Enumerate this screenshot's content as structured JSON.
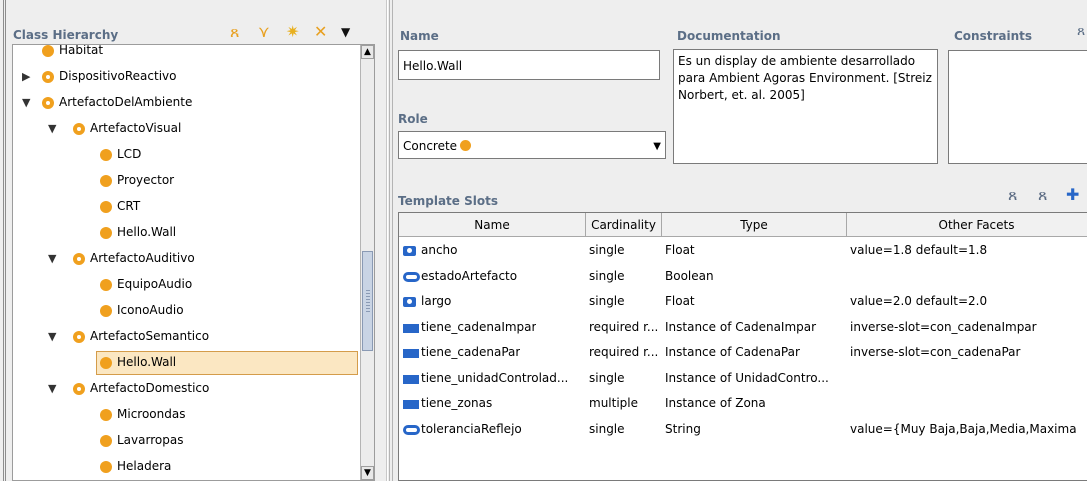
{
  "left": {
    "title": "Class Hierarchy",
    "header_icons": [
      "add-subclass-icon",
      "create-class-icon",
      "properties-icon",
      "delete-icon",
      "menu-chevron-icon"
    ],
    "tree": [
      {
        "label": "Habitat",
        "depth": 1,
        "toggle": "",
        "open": false,
        "selected": false
      },
      {
        "label": "DispositivoReactivo",
        "depth": 1,
        "toggle": "▶",
        "open": true,
        "selected": false
      },
      {
        "label": "ArtefactoDelAmbiente",
        "depth": 1,
        "toggle": "▼",
        "open": true,
        "selected": false
      },
      {
        "label": "ArtefactoVisual",
        "depth": 2,
        "toggle": "▼",
        "open": true,
        "selected": false
      },
      {
        "label": "LCD",
        "depth": 3,
        "toggle": "",
        "open": false,
        "selected": false
      },
      {
        "label": "Proyector",
        "depth": 3,
        "toggle": "",
        "open": false,
        "selected": false
      },
      {
        "label": "CRT",
        "depth": 3,
        "toggle": "",
        "open": false,
        "selected": false
      },
      {
        "label": "Hello.Wall",
        "depth": 3,
        "toggle": "",
        "open": false,
        "selected": false
      },
      {
        "label": "ArtefactoAuditivo",
        "depth": 2,
        "toggle": "▼",
        "open": true,
        "selected": false
      },
      {
        "label": "EquipoAudio",
        "depth": 3,
        "toggle": "",
        "open": false,
        "selected": false
      },
      {
        "label": "IconoAudio",
        "depth": 3,
        "toggle": "",
        "open": false,
        "selected": false
      },
      {
        "label": "ArtefactoSemantico",
        "depth": 2,
        "toggle": "▼",
        "open": true,
        "selected": false
      },
      {
        "label": "Hello.Wall",
        "depth": 3,
        "toggle": "",
        "open": false,
        "selected": true
      },
      {
        "label": "ArtefactoDomestico",
        "depth": 2,
        "toggle": "▼",
        "open": true,
        "selected": false
      },
      {
        "label": "Microondas",
        "depth": 3,
        "toggle": "",
        "open": false,
        "selected": false
      },
      {
        "label": "Lavarropas",
        "depth": 3,
        "toggle": "",
        "open": false,
        "selected": false
      },
      {
        "label": "Heladera",
        "depth": 3,
        "toggle": "",
        "open": false,
        "selected": false
      }
    ]
  },
  "form": {
    "name_label": "Name",
    "name_value": "Hello.Wall",
    "documentation_label": "Documentation",
    "documentation_text": "Es un display de ambiente desarrollado para Ambient Agoras Environment. [Streiz Norbert, et. al. 2005]",
    "constraints_label": "Constraints",
    "role_label": "Role",
    "role_value": "Concrete"
  },
  "slots": {
    "title": "Template Slots",
    "columns": [
      "Name",
      "Cardinality",
      "Type",
      "Other Facets"
    ],
    "rows": [
      {
        "icon": "float-slot-icon",
        "name": "ancho",
        "cardinality": "single",
        "type": "Float",
        "facets": "value=1.8 default=1.8"
      },
      {
        "icon": "boolean-slot-icon",
        "name": "estadoArtefacto",
        "cardinality": "single",
        "type": "Boolean",
        "facets": ""
      },
      {
        "icon": "float-slot-icon",
        "name": "largo",
        "cardinality": "single",
        "type": "Float",
        "facets": "value=2.0 default=2.0"
      },
      {
        "icon": "instance-slot-icon",
        "name": "tiene_cadenaImpar",
        "cardinality": "required r...",
        "type": "Instance of CadenaImpar",
        "facets": "inverse-slot=con_cadenaImpar"
      },
      {
        "icon": "instance-slot-icon",
        "name": "tiene_cadenaPar",
        "cardinality": "required r...",
        "type": "Instance of CadenaPar",
        "facets": "inverse-slot=con_cadenaPar"
      },
      {
        "icon": "instance-slot-icon",
        "name": "tiene_unidadControlad...",
        "cardinality": "single",
        "type": "Instance of UnidadContro...",
        "facets": ""
      },
      {
        "icon": "instance-slot-icon",
        "name": "tiene_zonas",
        "cardinality": "multiple",
        "type": "Instance of Zona",
        "facets": ""
      },
      {
        "icon": "string-slot-icon",
        "name": "toleranciaReflejo",
        "cardinality": "single",
        "type": "String",
        "facets": "value={Muy Baja,Baja,Media,Maxima"
      }
    ]
  }
}
